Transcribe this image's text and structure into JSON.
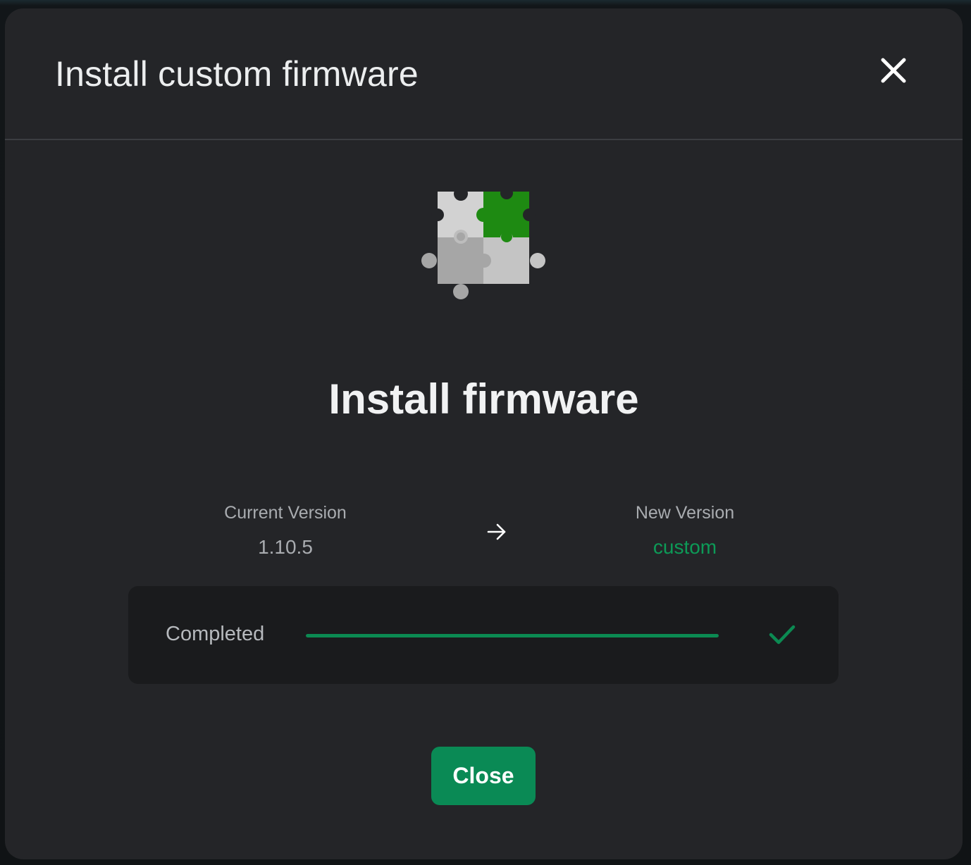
{
  "modal": {
    "title": "Install custom firmware",
    "heading": "Install firmware"
  },
  "versions": {
    "current_label": "Current Version",
    "current_value": "1.10.5",
    "new_label": "New Version",
    "new_value": "custom"
  },
  "progress": {
    "status": "Completed",
    "percent": 100
  },
  "footer": {
    "close_label": "Close"
  },
  "icons": {
    "header_close": "close-icon",
    "hero": "puzzle-pieces-icon",
    "arrow": "arrow-right-icon",
    "status": "checkmark-icon"
  },
  "colors": {
    "accent": "#0a8a55",
    "new_version_text": "#0d9a57",
    "puzzle_green": "#1e8a12"
  }
}
